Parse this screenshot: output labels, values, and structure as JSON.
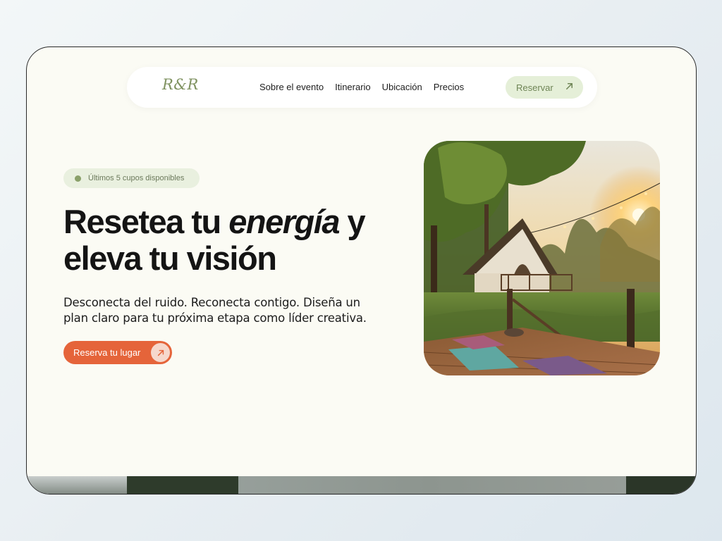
{
  "brand": {
    "logo": "R&R"
  },
  "nav": {
    "links": [
      "Sobre el evento",
      "Itinerario",
      "Ubicación",
      "Precios"
    ],
    "cta_label": "Reservar"
  },
  "hero": {
    "badge": "Últimos 5 cupos disponibles",
    "headline_part1": "Resetea tu ",
    "headline_em": "energía",
    "headline_part2": " y eleva tu visión",
    "subtitle": "Desconecta del ruido. Reconecta contigo. Diseña un plan claro para tu próxima etapa como líder creativa.",
    "cta_label": "Reserva tu lugar"
  },
  "colors": {
    "accent_orange": "#e5643a",
    "accent_green": "#7f9260",
    "background": "#fbfbf4"
  },
  "icons": {
    "nav_cta": "arrow-up-right-icon",
    "hero_cta": "arrow-up-right-icon",
    "badge": "status-dot-icon"
  }
}
